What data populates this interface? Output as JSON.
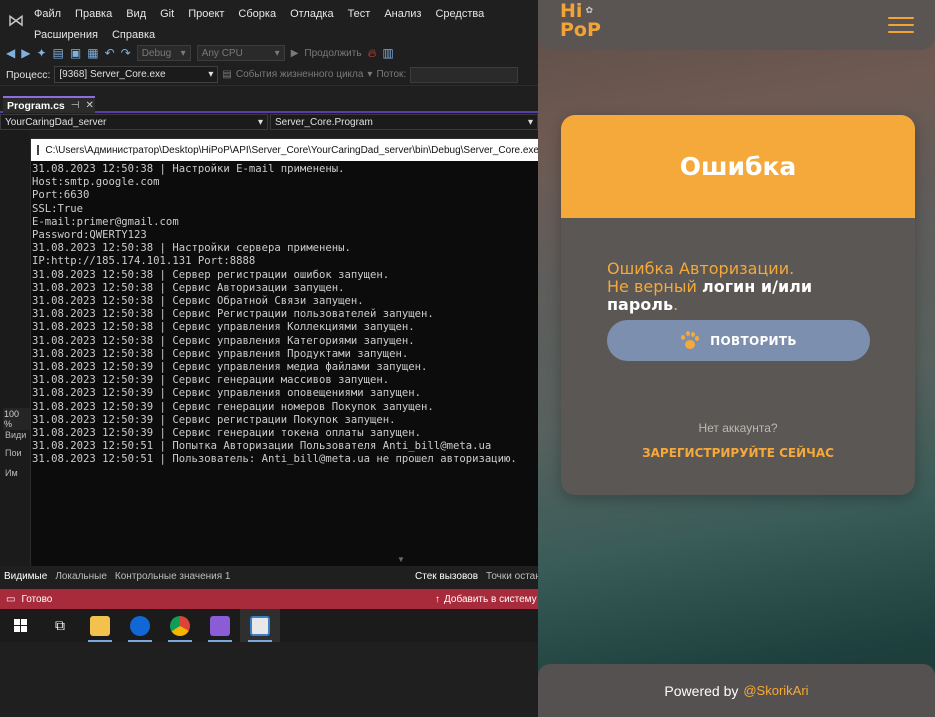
{
  "vs": {
    "menu": [
      "Файл",
      "Правка",
      "Вид",
      "Git",
      "Проект",
      "Сборка",
      "Отладка",
      "Тест",
      "Анализ",
      "Средства",
      "Расширения",
      "Справка"
    ],
    "toolbar": {
      "config": "Debug",
      "platform": "Any CPU",
      "continue": "Продолжить"
    },
    "process": {
      "label": "Процесс:",
      "value": "[9368] Server_Core.exe",
      "lifecycle": "События жизненного цикла",
      "thread": "Поток:"
    },
    "tab": {
      "label": "Program.cs"
    },
    "nav": {
      "project": "YourCaringDad_server",
      "class": "Server_Core.Program"
    },
    "side": {
      "a": "Види",
      "b": "Пои",
      "c": "Им",
      "zoom": "100 %"
    },
    "console": {
      "title": "C:\\Users\\Администратор\\Desktop\\HiPoP\\API\\Server_Core\\YourCaringDad_server\\bin\\Debug\\Server_Core.exe",
      "lines": [
        "31.08.2023 12:50:38 | Настройки E-mail применены.",
        "Host:smtp.google.com",
        "Port:6630",
        "SSL:True",
        "E-mail:primer@gmail.com",
        "Password:QWERTY123",
        "31.08.2023 12:50:38 | Настройки сервера применены.",
        "IP:http://185.174.101.131 Port:8888",
        "31.08.2023 12:50:38 | Сервер регистрации ошибок запущен.",
        "31.08.2023 12:50:38 | Сервис Авторизации запущен.",
        "31.08.2023 12:50:38 | Сервис Обратной Связи запущен.",
        "31.08.2023 12:50:38 | Сервис Регистрации пользователей запущен.",
        "31.08.2023 12:50:38 | Сервис управления Коллекциями запущен.",
        "31.08.2023 12:50:38 | Сервис управления Категориями запущен.",
        "31.08.2023 12:50:38 | Сервис управления Продуктами запущен.",
        "31.08.2023 12:50:39 | Сервис управления медиа файлами запущен.",
        "31.08.2023 12:50:39 | Сервис генерации массивов запущен.",
        "31.08.2023 12:50:39 | Сервис управления оповещениями запущен.",
        "31.08.2023 12:50:39 | Сервис генерации номеров Покупок запущен.",
        "31.08.2023 12:50:39 | Сервис регистрации Покупок запущен.",
        "31.08.2023 12:50:39 | Сервис генерации токена оплаты запущен.",
        "31.08.2023 12:50:51 | Попытка Авторизации Пользователя Anti_bill@meta.ua",
        "31.08.2023 12:50:51 | Пользователь: Anti_bill@meta.ua не прошел авторизацию."
      ]
    },
    "bottom_tabs": [
      "Видимые",
      "Локальные",
      "Контрольные значения 1"
    ],
    "bottom_tabs_right": [
      "Стек вызовов",
      "Точки остан"
    ],
    "status": {
      "ready": "Готово",
      "source_control": "Добавить в систему"
    }
  },
  "app": {
    "logo": {
      "line1": "Hi",
      "line2": "PoP"
    },
    "error": {
      "title": "Ошибка",
      "msg_part1": "Ошибка Авторизации.",
      "msg_part2": "Не верный",
      "msg_part3": "логин и/или пароль",
      "msg_part4": "."
    },
    "retry_label": "ПОВТОРИТЬ",
    "no_account": "Нет аккаунта?",
    "register": "ЗАРЕГИСТРИРУЙТЕ СЕЙЧАС",
    "footer": {
      "powered": "Powered by",
      "author": "@SkorikAri"
    },
    "colors": {
      "accent": "#f5a93a",
      "button": "#7c8fae",
      "card": "#5a5755"
    }
  }
}
